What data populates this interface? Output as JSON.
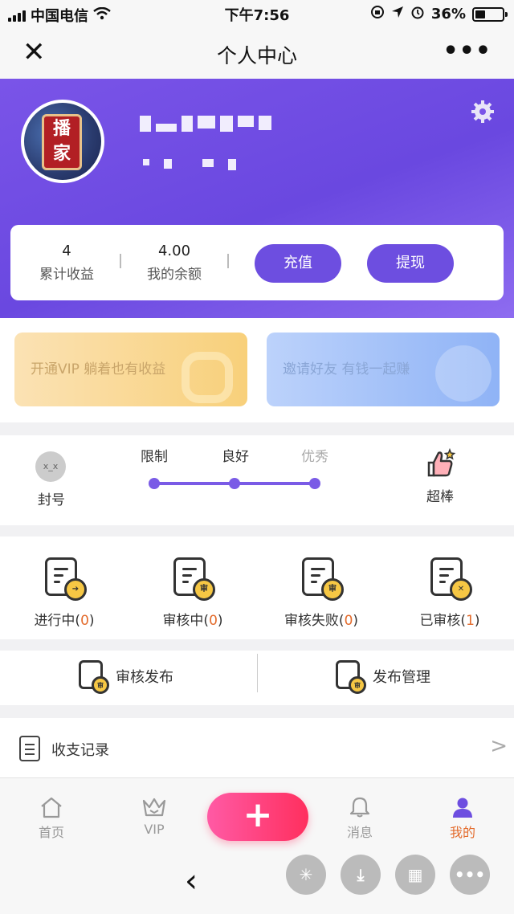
{
  "status_bar": {
    "carrier": "中国电信",
    "time": "下午7:56",
    "battery": "36%"
  },
  "nav": {
    "title": "个人中心",
    "close_icon": "close-icon",
    "more_icon": "more-icon"
  },
  "profile": {
    "avatar_text_1": "播",
    "avatar_text_2": "家",
    "settings_icon": "gear-icon"
  },
  "stats": {
    "total_earnings_value": "4",
    "total_earnings_label": "累计收益",
    "balance_value": "4.00",
    "balance_label": "我的余额",
    "recharge_label": "充值",
    "withdraw_label": "提现"
  },
  "banners": {
    "vip": "开通VIP 躺着也有收益",
    "invite": "邀请好友 有钱一起赚"
  },
  "level": {
    "current_label": "封号",
    "steps": [
      "限制",
      "良好",
      "优秀"
    ],
    "progress_fraction": 1.0,
    "top_label": "超棒"
  },
  "tasks": [
    {
      "label": "进行中(",
      "count": "0",
      "close": ")",
      "icon": "arrow-right-icon"
    },
    {
      "label": "审核中(",
      "count": "0",
      "close": ")",
      "icon": "audit-icon"
    },
    {
      "label": "审核失败(",
      "count": "0",
      "close": ")",
      "icon": "audit-icon"
    },
    {
      "label": "已审核(",
      "count": "1",
      "close": ")",
      "icon": "x-icon"
    }
  ],
  "publish": {
    "audit_publish": "审核发布",
    "publish_manage": "发布管理",
    "coin_text": "审"
  },
  "ledger": {
    "label": "收支记录",
    "arrow": ">"
  },
  "tabbar": {
    "items": [
      {
        "label": "首页",
        "icon": "home-icon"
      },
      {
        "label": "VIP",
        "icon": "crown-icon"
      },
      {
        "label": "消息",
        "icon": "bell-icon"
      },
      {
        "label": "我的",
        "icon": "user-icon"
      }
    ],
    "fab": "+",
    "active_color": "#e36b2c",
    "accent_color": "#6d4ee0"
  }
}
